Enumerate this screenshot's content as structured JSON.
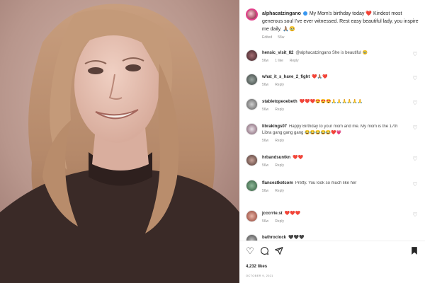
{
  "post": {
    "username": "alphacatzingano",
    "caption": "My Mom's birthday today ❤️ Kindest most generous soul I've ever witnessed. Rest easy beautiful lady, you inspire me daily. 🙏🏽🥹",
    "time_label": "Edited",
    "age_label": "56w"
  },
  "comments": [
    {
      "user": "hensic_visit_82",
      "text": "@alphacatzingano She is beautiful 🥹",
      "age": "56w",
      "likes": "1 like",
      "reply": "Reply"
    },
    {
      "user": "what_it_s_have_2_fight",
      "text": "❤️🙏🏽❤️",
      "age": "56w",
      "likes": "",
      "reply": "Reply"
    },
    {
      "user": "stabletopeoebeth",
      "text": "❤️❤️❤️😍😍😍🙏🙏🙏🙏🙏🙏",
      "age": "56w",
      "likes": "",
      "reply": "Reply"
    },
    {
      "user": "librakings07",
      "text": "Happy Birthday to your mom and me. My mom is the 17th Libra gang gang gang 😂😂😂😂😂❤️💗",
      "age": "56w",
      "likes": "",
      "reply": "Reply"
    },
    {
      "user": "hrbandsuntkn",
      "text": "❤️❤️",
      "age": "56w",
      "likes": "",
      "reply": "Reply"
    },
    {
      "user": "flancestketcom",
      "text": "Pretty. You look so much like her",
      "age": "56w",
      "likes": "",
      "reply": "Reply"
    },
    {
      "user": "jcccrrte.st",
      "text": "❤️❤️❤️",
      "age": "56w",
      "likes": "",
      "reply": "Reply"
    },
    {
      "user": "bathroclock",
      "text": "🖤🖤🖤",
      "age": "",
      "likes": "",
      "reply": ""
    }
  ],
  "icons": {
    "like": "heart-icon",
    "comment": "comment-icon",
    "share": "share-icon",
    "save": "bookmark-icon"
  },
  "likes_label": "4,232 likes",
  "date_label": "OCTOBER 9, 2021",
  "colors": {
    "verified": "#3897f0",
    "story_ring": "#e23f8a"
  }
}
